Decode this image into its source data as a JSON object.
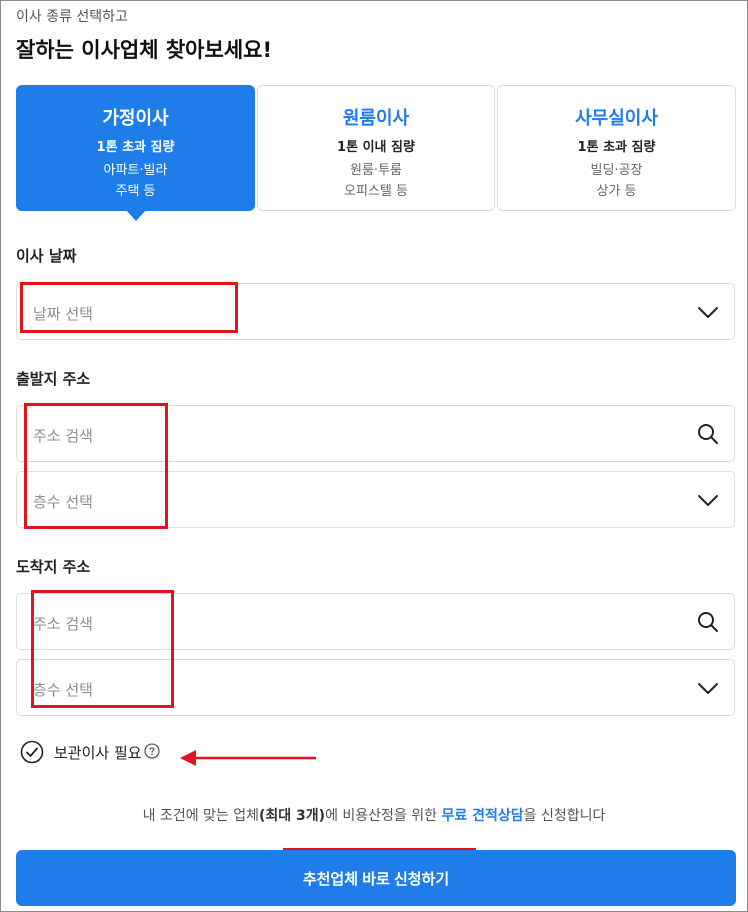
{
  "header": {
    "subtitle": "이사 종류 선택하고",
    "title": "잘하는 이사업체 찾아보세요!"
  },
  "move_types": [
    {
      "name": "가정이사",
      "load": "1톤 초과 짐량",
      "desc1": "아파트·빌라",
      "desc2": "주택 등",
      "selected": true
    },
    {
      "name": "원룸이사",
      "load": "1톤 이내 짐량",
      "desc1": "원룸·투룸",
      "desc2": "오피스텔 등",
      "selected": false
    },
    {
      "name": "사무실이사",
      "load": "1톤 초과 짐량",
      "desc1": "빌딩·공장",
      "desc2": "상가 등",
      "selected": false
    }
  ],
  "move_date": {
    "label": "이사 날짜",
    "placeholder": "날짜 선택",
    "icon": "chevron-down-icon"
  },
  "origin": {
    "label": "출발지 주소",
    "address_placeholder": "주소 검색",
    "address_icon": "search-icon",
    "floor_placeholder": "층수 선택",
    "floor_icon": "chevron-down-icon"
  },
  "destination": {
    "label": "도착지 주소",
    "address_placeholder": "주소 검색",
    "address_icon": "search-icon",
    "floor_placeholder": "층수 선택",
    "floor_icon": "chevron-down-icon"
  },
  "storage_option": {
    "label": "보관이사 필요",
    "checked": false,
    "help_icon": "question-circle-icon"
  },
  "notice": {
    "part1": "내 조건에 맞는 업체",
    "part2": "(최대 3개)",
    "part3": "에 비용산정을 위한 ",
    "part4": "무료 견적상담",
    "part5": "을 신청합니다"
  },
  "cta": {
    "label": "추천업체 바로 신청하기"
  },
  "colors": {
    "accent": "#1f7de9",
    "highlight": "#e0141e",
    "border": "#dcdcdc",
    "placeholder": "#8e8e8e"
  }
}
